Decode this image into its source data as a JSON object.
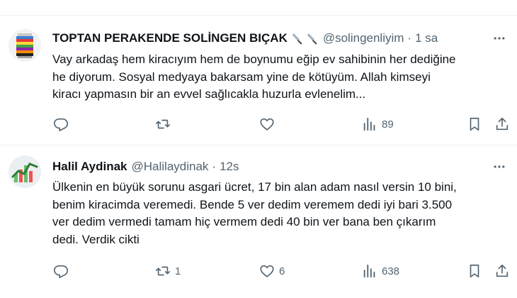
{
  "tweets": [
    {
      "display_name": "TOPTAN PERAKENDE SOLİNGEN BIÇAK",
      "handle": "@solingenliyim",
      "dot": "·",
      "time": "1 sa",
      "text_lines": [
        "Vay arkadaş hem kiracıyım hem de boynumu eğip ev sahibinin her dediğine",
        "he diyorum. Sosyal medyaya bakarsam yine de kötüyüm. Allah kimseyi",
        "kiracı yapmasın bir an evvel sağlıcakla huzurla evlenelim..."
      ],
      "reply_count": "",
      "retweet_count": "",
      "like_count": "",
      "view_count": "89",
      "badge_icons": [
        "knife-emoji-icon",
        "knife-emoji-icon"
      ]
    },
    {
      "display_name": "Halil Aydinak",
      "handle": "@Halilaydinak",
      "dot": "·",
      "time": "12s",
      "text_lines": [
        "Ülkenin en büyük sorunu asgari ücret, 17 bin alan adam nasıl versin 10 bini,",
        "benim kiracimda veremedi. Bende 5 ver dedim veremem dedi iyi bari 3.500",
        "ver dedim vermedi tamam hiç vermem dedi 40 bin ver bana ben çıkarım",
        "dedi. Verdik cikti"
      ],
      "reply_count": "",
      "retweet_count": "1",
      "like_count": "6",
      "view_count": "638"
    }
  ],
  "icons": {
    "more": "more-dots-icon",
    "reply": "reply-icon",
    "retweet": "retweet-icon",
    "like": "heart-icon",
    "views": "views-icon",
    "bookmark": "bookmark-icon",
    "share": "share-icon"
  },
  "colors": {
    "text": "#0f1419",
    "muted": "#536471",
    "divider": "#eff3f4",
    "background": "#ffffff"
  }
}
